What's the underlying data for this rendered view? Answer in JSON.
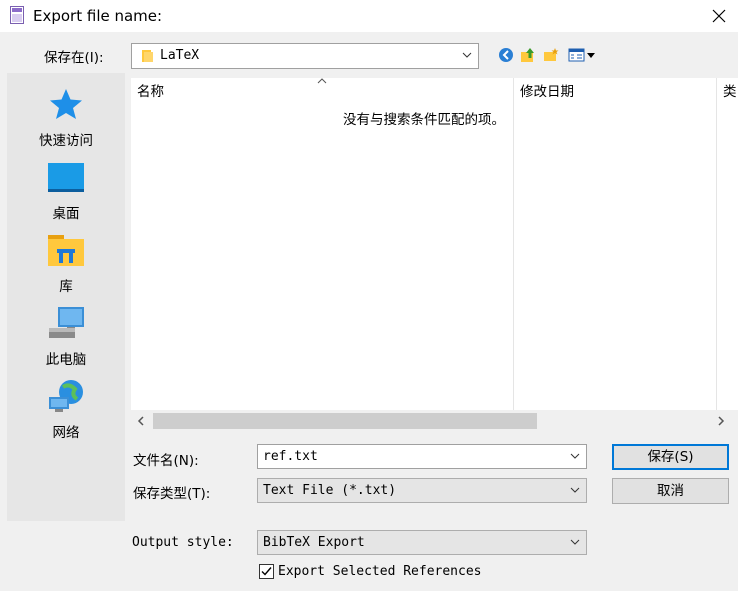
{
  "window": {
    "title": "Export file name:"
  },
  "save_in": {
    "label": "保存在(I):",
    "value": "LaTeX"
  },
  "places": [
    {
      "label": "快速访问",
      "icon": "star-icon"
    },
    {
      "label": "桌面",
      "icon": "desktop-icon"
    },
    {
      "label": "库",
      "icon": "library-icon"
    },
    {
      "label": "此电脑",
      "icon": "computer-icon"
    },
    {
      "label": "网络",
      "icon": "network-icon"
    }
  ],
  "file_list": {
    "columns": [
      "名称",
      "修改日期",
      "类"
    ],
    "empty_message": "没有与搜索条件匹配的项。"
  },
  "file_name": {
    "label": "文件名(N):",
    "value": "ref.txt"
  },
  "file_type": {
    "label": "保存类型(T):",
    "value": "Text File (*.txt)"
  },
  "output_style": {
    "label": "Output style:",
    "value": "BibTeX Export"
  },
  "buttons": {
    "save": "保存(S)",
    "cancel": "取消"
  },
  "export_selected": {
    "label": "Export Selected References",
    "checked": true
  },
  "colors": {
    "accent": "#0078d7",
    "star": "#1e8fe8",
    "folder": "#ffc83d"
  }
}
